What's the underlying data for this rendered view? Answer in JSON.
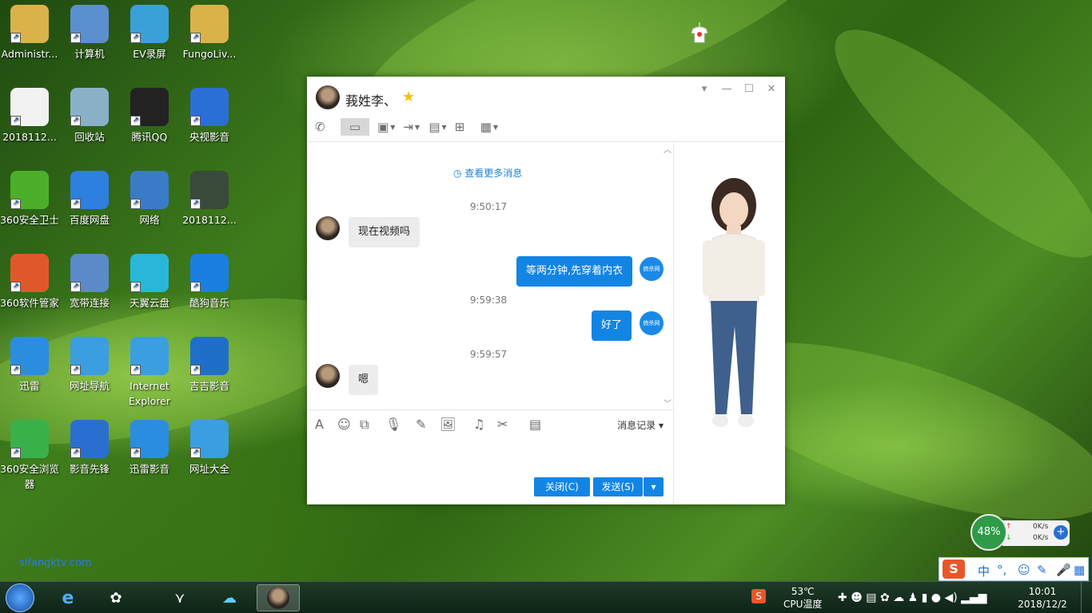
{
  "desktop": {
    "icons": [
      {
        "label": "Administr...",
        "icon": "user-folder-icon",
        "color": "#d9b24a"
      },
      {
        "label": "计算机",
        "icon": "computer-icon",
        "color": "#5b8fd0"
      },
      {
        "label": "EV录屏",
        "icon": "ev-recorder-icon",
        "color": "#3aa0d8"
      },
      {
        "label": "FungoLiv...",
        "icon": "folder-icon",
        "color": "#d9b24a"
      },
      {
        "label": "2018112...",
        "icon": "blank-file-icon",
        "color": "#f2f2f2"
      },
      {
        "label": "回收站",
        "icon": "recycle-bin-icon",
        "color": "#8ab0c8"
      },
      {
        "label": "腾讯QQ",
        "icon": "qq-penguin-icon",
        "color": "#222222"
      },
      {
        "label": "央视影音",
        "icon": "cctv-player-icon",
        "color": "#2b6fd6"
      },
      {
        "label": "360安全卫士",
        "icon": "360-guard-icon",
        "color": "#4caf2a"
      },
      {
        "label": "百度网盘",
        "icon": "baidu-netdisk-icon",
        "color": "#2d7fe0"
      },
      {
        "label": "网络",
        "icon": "network-icon",
        "color": "#3a7bc8"
      },
      {
        "label": "2018112...",
        "icon": "video-file-icon",
        "color": "#3a4a3a"
      },
      {
        "label": "360软件管家",
        "icon": "360-software-icon",
        "color": "#e0582a"
      },
      {
        "label": "宽带连接",
        "icon": "broadband-icon",
        "color": "#5a8ac8"
      },
      {
        "label": "天翼云盘",
        "icon": "tianyi-cloud-icon",
        "color": "#28b7d8"
      },
      {
        "label": "酷狗音乐",
        "icon": "kugou-music-icon",
        "color": "#1a7fe0"
      },
      {
        "label": "迅雷",
        "icon": "xunlei-icon",
        "color": "#2a8de0"
      },
      {
        "label": "网址导航",
        "icon": "ie-icon",
        "color": "#3a9ee0"
      },
      {
        "label": "Internet Explorer",
        "icon": "ie-icon",
        "color": "#3a9ee0"
      },
      {
        "label": "吉吉影音",
        "icon": "jiji-player-icon",
        "color": "#1f6fc8"
      },
      {
        "label": "360安全浏览器",
        "icon": "360-browser-icon",
        "color": "#3ab04a"
      },
      {
        "label": "影音先锋",
        "icon": "xfplay-icon",
        "color": "#2a6fd0"
      },
      {
        "label": "迅雷影音",
        "icon": "xunlei-player-icon",
        "color": "#2a8de0"
      },
      {
        "label": "网址大全",
        "icon": "ie-icon",
        "color": "#3a9ee0"
      }
    ],
    "watermark": "sifangktv.com"
  },
  "chat": {
    "contact_name": "莪姓李、",
    "star_icon": "star-icon",
    "toolbar": [
      "phone-icon",
      "video-icon",
      "screen-share-icon",
      "file-transfer-icon",
      "remote-desktop-icon",
      "app-icon",
      "more-apps-icon"
    ],
    "view_more": "查看更多消息",
    "messages": [
      {
        "time": "9:50:17"
      },
      {
        "side": "in",
        "text": "现在视频吗"
      },
      {
        "side": "out",
        "text": "等两分钟,先穿着内衣"
      },
      {
        "time": "9:59:38"
      },
      {
        "side": "out",
        "text": "好了"
      },
      {
        "time": "9:59:57"
      },
      {
        "side": "in",
        "text": "嗯"
      }
    ],
    "my_avatar_text": "俯杀网",
    "history_label": "消息记录",
    "close_label": "关闭(C)",
    "send_label": "发送(S)"
  },
  "netmon": {
    "percent": "48%",
    "up": "0K/s",
    "down": "0K/s"
  },
  "ime": [
    "中",
    "°,",
    "☺",
    "✎",
    "🎤",
    "▦"
  ],
  "taskbar": {
    "cpu_temp": "53℃",
    "cpu_label": "CPU温度",
    "time": "10:01",
    "date": "2018/12/2"
  }
}
